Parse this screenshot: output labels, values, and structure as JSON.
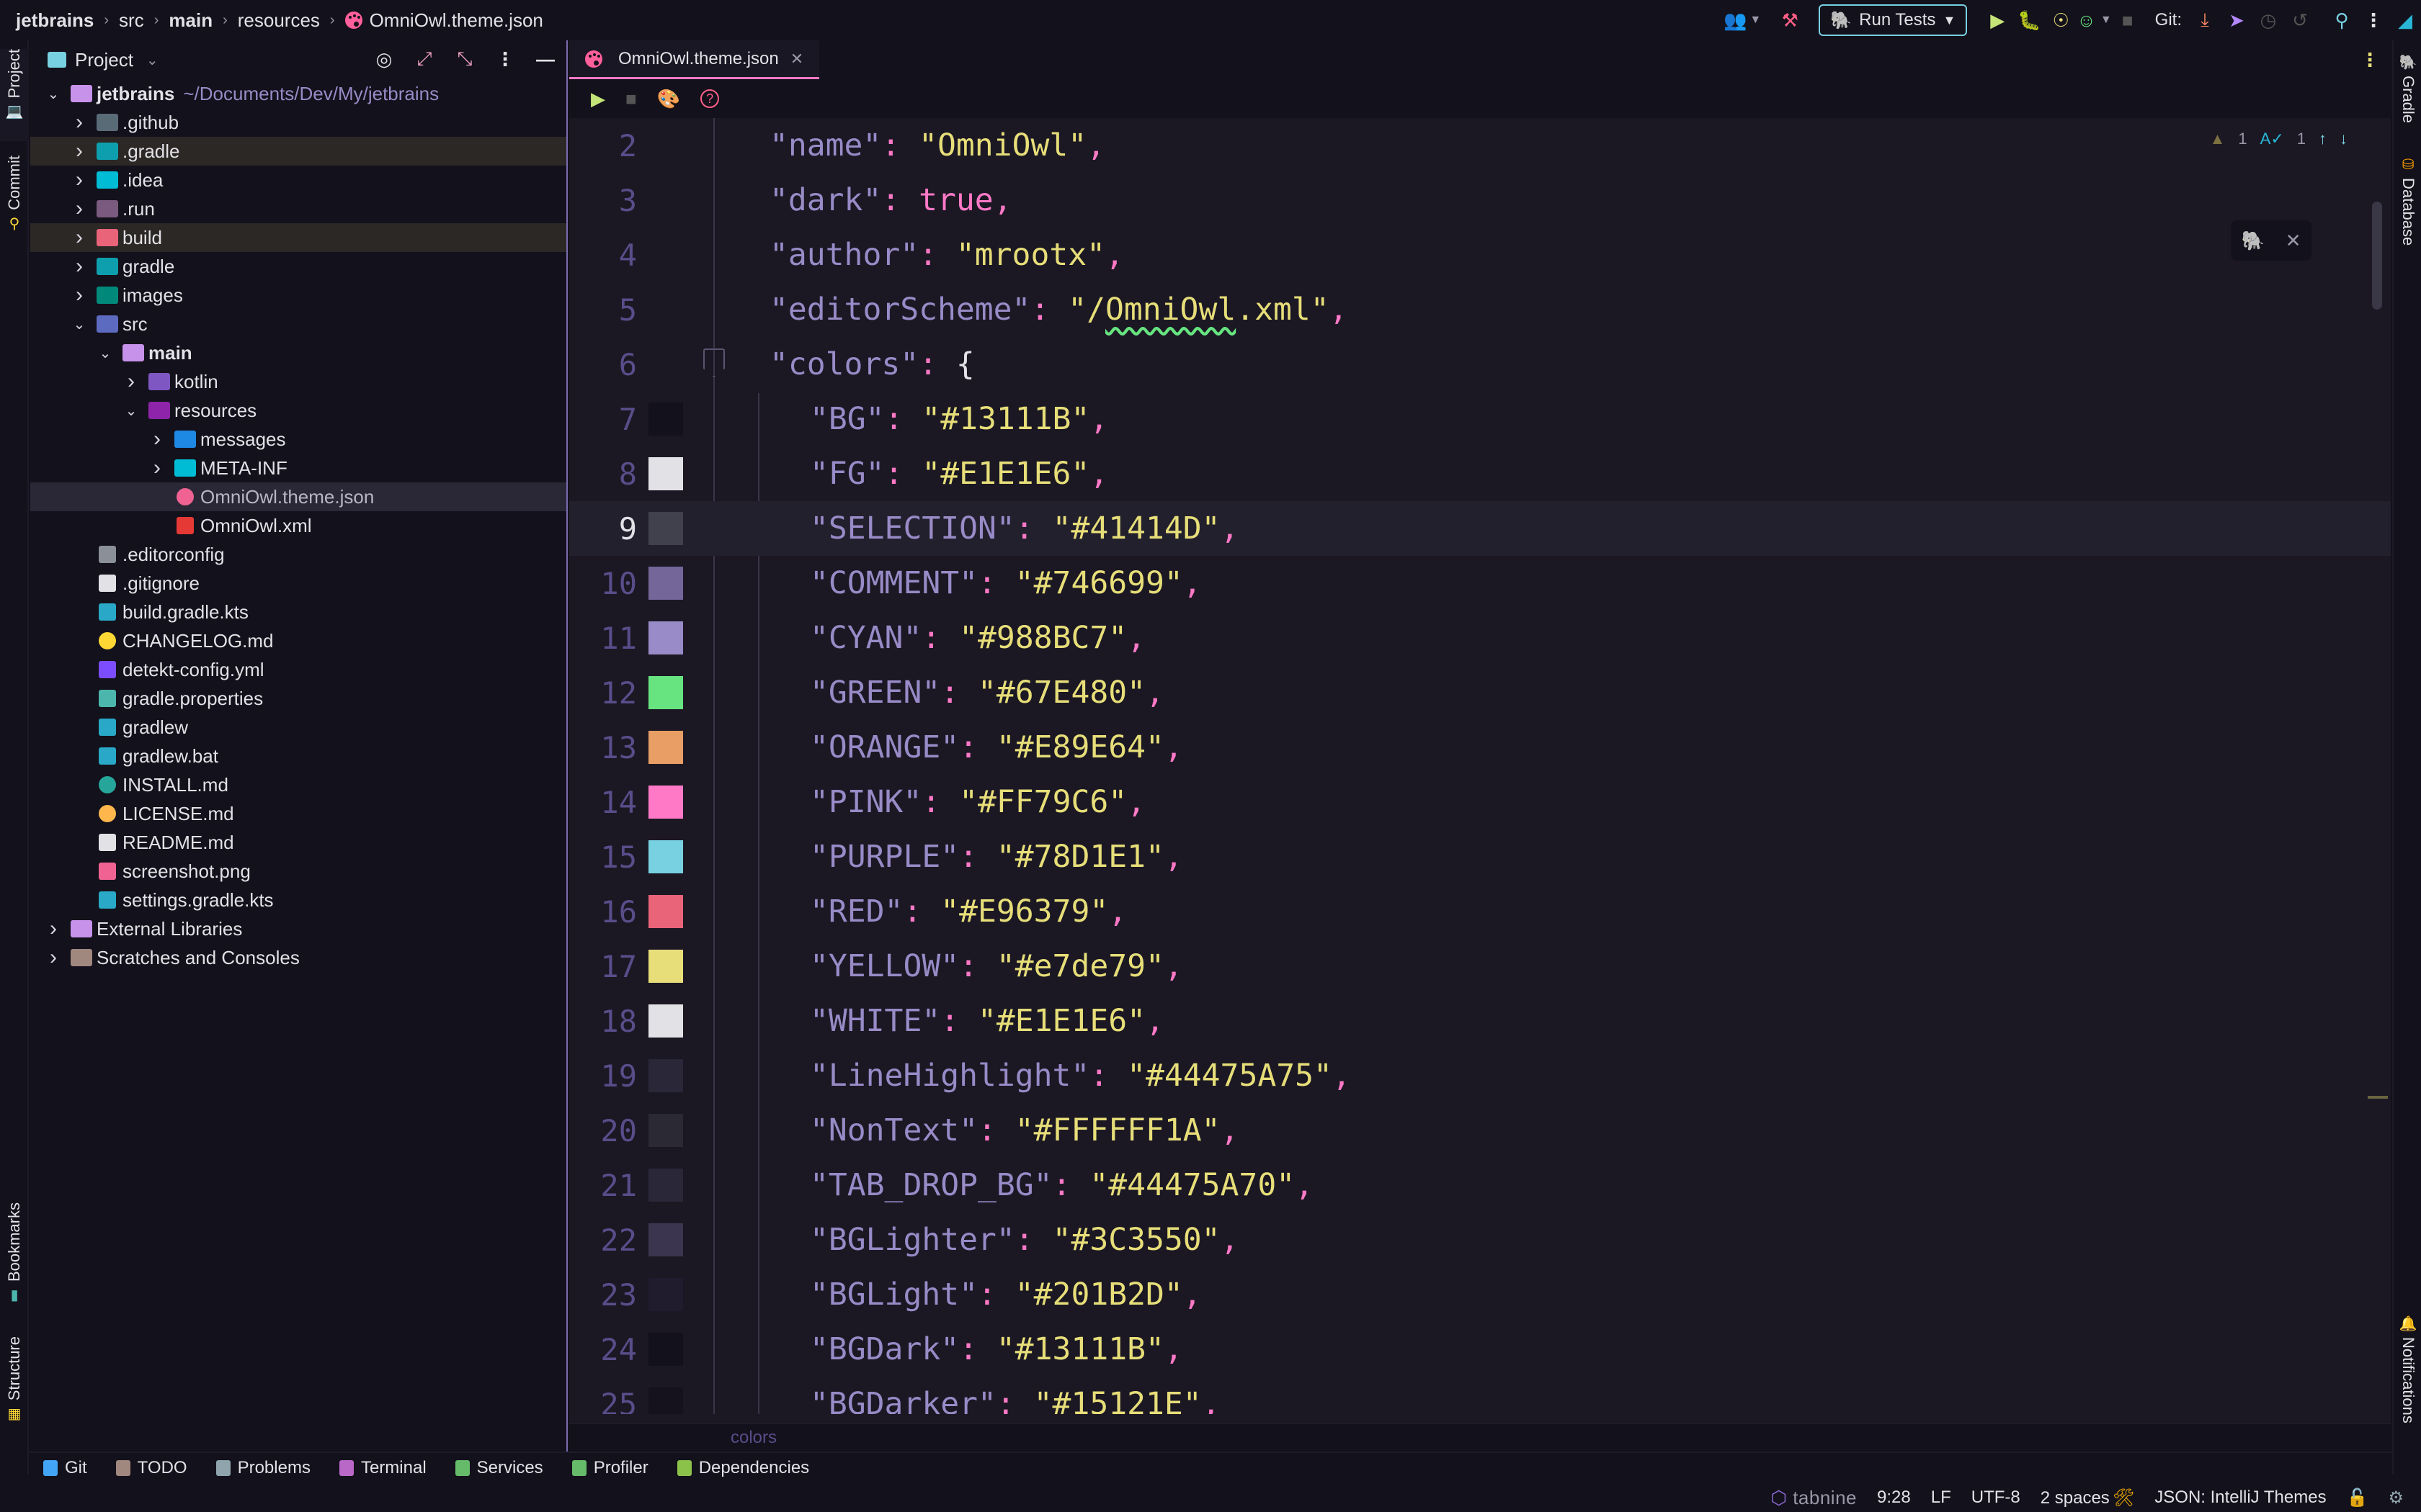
{
  "breadcrumb": [
    {
      "label": "jetbrains",
      "bold": true
    },
    {
      "label": "src",
      "bold": false
    },
    {
      "label": "main",
      "bold": true
    },
    {
      "label": "resources",
      "bold": false
    },
    {
      "label": "OmniOwl.theme.json",
      "bold": false,
      "icon": "palette-icon"
    }
  ],
  "toolbar": {
    "run_config_label": "Run Tests",
    "git_label": "Git:"
  },
  "left_strip": {
    "top": [
      {
        "label": "Project",
        "icon": "laptop-icon"
      },
      {
        "label": "Commit",
        "icon": "commit-icon"
      }
    ],
    "bottom": [
      {
        "label": "Bookmarks",
        "icon": "bookmark-icon"
      },
      {
        "label": "Structure",
        "icon": "structure-icon"
      }
    ]
  },
  "right_strip": {
    "top": [
      {
        "label": "Gradle",
        "icon": "gradle-icon"
      },
      {
        "label": "Database",
        "icon": "database-icon"
      }
    ],
    "bottom": [
      {
        "label": "Notifications",
        "icon": "bell-icon"
      }
    ]
  },
  "project_panel": {
    "title": "Project",
    "tree": [
      {
        "depth": 0,
        "arrow": "down",
        "name": "jetbrains",
        "path": "~/Documents/Dev/My/jetbrains",
        "bold": true,
        "icon": "module-folder",
        "color": "#C792EA"
      },
      {
        "depth": 1,
        "arrow": "right",
        "name": ".github",
        "icon": "github-folder",
        "color": "#5a6b78"
      },
      {
        "depth": 1,
        "arrow": "right",
        "name": ".gradle",
        "icon": "gradle-folder",
        "color": "#0e9fae",
        "state": "ignored"
      },
      {
        "depth": 1,
        "arrow": "right",
        "name": ".idea",
        "icon": "idea-folder",
        "color": "#00bcd4"
      },
      {
        "depth": 1,
        "arrow": "right",
        "name": ".run",
        "icon": "run-folder",
        "color": "#7a5a7e"
      },
      {
        "depth": 1,
        "arrow": "right",
        "name": "build",
        "icon": "build-folder",
        "color": "#E96379",
        "state": "ignored"
      },
      {
        "depth": 1,
        "arrow": "right",
        "name": "gradle",
        "icon": "gradle-folder",
        "color": "#0e9fae"
      },
      {
        "depth": 1,
        "arrow": "right",
        "name": "images",
        "icon": "images-folder",
        "color": "#00897b"
      },
      {
        "depth": 1,
        "arrow": "down",
        "name": "src",
        "icon": "src-folder",
        "color": "#5c6bc0"
      },
      {
        "depth": 2,
        "arrow": "down",
        "name": "main",
        "bold": true,
        "icon": "main-folder",
        "color": "#C792EA"
      },
      {
        "depth": 3,
        "arrow": "right",
        "name": "kotlin",
        "icon": "kotlin-folder",
        "color": "#7e57c2"
      },
      {
        "depth": 3,
        "arrow": "down",
        "name": "resources",
        "icon": "resources-folder",
        "color": "#8e24aa"
      },
      {
        "depth": 4,
        "arrow": "right",
        "name": "messages",
        "icon": "messages-folder",
        "color": "#1e88e5"
      },
      {
        "depth": 4,
        "arrow": "right",
        "name": "META-INF",
        "icon": "metainf-folder",
        "color": "#00bcd4"
      },
      {
        "depth": 4,
        "arrow": "none",
        "name": "OmniOwl.theme.json",
        "icon": "palette-file",
        "color": "#F06292",
        "state": "selected"
      },
      {
        "depth": 4,
        "arrow": "none",
        "name": "OmniOwl.xml",
        "icon": "xml-file",
        "color": "#E53935"
      },
      {
        "depth": 1,
        "arrow": "none",
        "name": ".editorconfig",
        "icon": "editorconfig-file",
        "color": "#8a8f98"
      },
      {
        "depth": 1,
        "arrow": "none",
        "name": ".gitignore",
        "icon": "git-file",
        "color": "#E1E1E6"
      },
      {
        "depth": 1,
        "arrow": "none",
        "name": "build.gradle.kts",
        "icon": "gradle-file",
        "color": "#29a8c7"
      },
      {
        "depth": 1,
        "arrow": "none",
        "name": "CHANGELOG.md",
        "icon": "changelog-file",
        "color": "#FDD835"
      },
      {
        "depth": 1,
        "arrow": "none",
        "name": "detekt-config.yml",
        "icon": "detekt-file",
        "color": "#7c4dff"
      },
      {
        "depth": 1,
        "arrow": "none",
        "name": "gradle.properties",
        "icon": "properties-file",
        "color": "#4db6ac"
      },
      {
        "depth": 1,
        "arrow": "none",
        "name": "gradlew",
        "icon": "gradle-file",
        "color": "#29a8c7"
      },
      {
        "depth": 1,
        "arrow": "none",
        "name": "gradlew.bat",
        "icon": "gradle-file",
        "color": "#29a8c7"
      },
      {
        "depth": 1,
        "arrow": "none",
        "name": "INSTALL.md",
        "icon": "install-file",
        "color": "#26a69a"
      },
      {
        "depth": 1,
        "arrow": "none",
        "name": "LICENSE.md",
        "icon": "license-file",
        "color": "#FFB74D"
      },
      {
        "depth": 1,
        "arrow": "none",
        "name": "README.md",
        "icon": "readme-file",
        "color": "#E1E1E6"
      },
      {
        "depth": 1,
        "arrow": "none",
        "name": "screenshot.png",
        "icon": "image-file",
        "color": "#F06292"
      },
      {
        "depth": 1,
        "arrow": "none",
        "name": "settings.gradle.kts",
        "icon": "gradle-file",
        "color": "#29a8c7"
      },
      {
        "depth": 0,
        "arrow": "right",
        "name": "External Libraries",
        "icon": "library-icon",
        "color": "#C792EA"
      },
      {
        "depth": 0,
        "arrow": "right",
        "name": "Scratches and Consoles",
        "icon": "scratches-icon",
        "color": "#a1887f"
      }
    ]
  },
  "editor": {
    "tab_label": "OmniOwl.theme.json",
    "inspections": {
      "warnings": "1",
      "typos": "1"
    },
    "breadcrumb": "colors",
    "current_line": 9,
    "lines": [
      {
        "n": "2",
        "indent": 1,
        "tokens": [
          [
            "k",
            "\"name\""
          ],
          [
            "p",
            ": "
          ],
          [
            "s",
            "\"OmniOwl\""
          ],
          [
            "p",
            ","
          ]
        ]
      },
      {
        "n": "3",
        "indent": 1,
        "tokens": [
          [
            "k",
            "\"dark\""
          ],
          [
            "p",
            ": "
          ],
          [
            "b",
            "true"
          ],
          [
            "p",
            ","
          ]
        ]
      },
      {
        "n": "4",
        "indent": 1,
        "tokens": [
          [
            "k",
            "\"author\""
          ],
          [
            "p",
            ": "
          ],
          [
            "s",
            "\"mrootx\""
          ],
          [
            "p",
            ","
          ]
        ]
      },
      {
        "n": "5",
        "indent": 1,
        "tokens": [
          [
            "k",
            "\"editorScheme\""
          ],
          [
            "p",
            ": "
          ],
          [
            "s",
            "\"/"
          ],
          [
            "sq",
            "OmniOwl"
          ],
          [
            "s",
            ".xml\""
          ],
          [
            "p",
            ","
          ]
        ]
      },
      {
        "n": "6",
        "indent": 1,
        "fold": true,
        "tokens": [
          [
            "k",
            "\"colors\""
          ],
          [
            "p",
            ": "
          ],
          [
            "w",
            "{"
          ]
        ]
      },
      {
        "n": "7",
        "indent": 2,
        "swatch": "#13111B",
        "tokens": [
          [
            "k",
            "\"BG\""
          ],
          [
            "p",
            ": "
          ],
          [
            "s",
            "\"#13111B\""
          ],
          [
            "p",
            ","
          ]
        ]
      },
      {
        "n": "8",
        "indent": 2,
        "swatch": "#E1E1E6",
        "tokens": [
          [
            "k",
            "\"FG\""
          ],
          [
            "p",
            ": "
          ],
          [
            "s",
            "\"#E1E1E6\""
          ],
          [
            "p",
            ","
          ]
        ]
      },
      {
        "n": "9",
        "indent": 2,
        "swatch": "#41414D",
        "tokens": [
          [
            "k",
            "\"SELECTION\""
          ],
          [
            "p",
            ": "
          ],
          [
            "s",
            "\"#41414D\""
          ],
          [
            "p",
            ","
          ]
        ]
      },
      {
        "n": "10",
        "indent": 2,
        "swatch": "#746699",
        "tokens": [
          [
            "k",
            "\"COMMENT\""
          ],
          [
            "p",
            ": "
          ],
          [
            "s",
            "\"#746699\""
          ],
          [
            "p",
            ","
          ]
        ]
      },
      {
        "n": "11",
        "indent": 2,
        "swatch": "#988BC7",
        "tokens": [
          [
            "k",
            "\"CYAN\""
          ],
          [
            "p",
            ": "
          ],
          [
            "s",
            "\"#988BC7\""
          ],
          [
            "p",
            ","
          ]
        ]
      },
      {
        "n": "12",
        "indent": 2,
        "swatch": "#67E480",
        "tokens": [
          [
            "k",
            "\"GREEN\""
          ],
          [
            "p",
            ": "
          ],
          [
            "s",
            "\"#67E480\""
          ],
          [
            "p",
            ","
          ]
        ]
      },
      {
        "n": "13",
        "indent": 2,
        "swatch": "#E89E64",
        "tokens": [
          [
            "k",
            "\"ORANGE\""
          ],
          [
            "p",
            ": "
          ],
          [
            "s",
            "\"#E89E64\""
          ],
          [
            "p",
            ","
          ]
        ]
      },
      {
        "n": "14",
        "indent": 2,
        "swatch": "#FF79C6",
        "tokens": [
          [
            "k",
            "\"PINK\""
          ],
          [
            "p",
            ": "
          ],
          [
            "s",
            "\"#FF79C6\""
          ],
          [
            "p",
            ","
          ]
        ]
      },
      {
        "n": "15",
        "indent": 2,
        "swatch": "#78D1E1",
        "tokens": [
          [
            "k",
            "\"PURPLE\""
          ],
          [
            "p",
            ": "
          ],
          [
            "s",
            "\"#78D1E1\""
          ],
          [
            "p",
            ","
          ]
        ]
      },
      {
        "n": "16",
        "indent": 2,
        "swatch": "#E96379",
        "tokens": [
          [
            "k",
            "\"RED\""
          ],
          [
            "p",
            ": "
          ],
          [
            "s",
            "\"#E96379\""
          ],
          [
            "p",
            ","
          ]
        ]
      },
      {
        "n": "17",
        "indent": 2,
        "swatch": "#e7de79",
        "tokens": [
          [
            "k",
            "\"YELLOW\""
          ],
          [
            "p",
            ": "
          ],
          [
            "s",
            "\"#e7de79\""
          ],
          [
            "p",
            ","
          ]
        ]
      },
      {
        "n": "18",
        "indent": 2,
        "swatch": "#E1E1E6",
        "tokens": [
          [
            "k",
            "\"WHITE\""
          ],
          [
            "p",
            ": "
          ],
          [
            "s",
            "\"#E1E1E6\""
          ],
          [
            "p",
            ","
          ]
        ]
      },
      {
        "n": "19",
        "indent": 2,
        "swatch": "#2a2838",
        "tokens": [
          [
            "k",
            "\"LineHighlight\""
          ],
          [
            "p",
            ": "
          ],
          [
            "s",
            "\"#44475A75\""
          ],
          [
            "p",
            ","
          ]
        ]
      },
      {
        "n": "20",
        "indent": 2,
        "swatch": "#2b2934",
        "tokens": [
          [
            "k",
            "\"NonText\""
          ],
          [
            "p",
            ": "
          ],
          [
            "s",
            "\"#FFFFFF1A\""
          ],
          [
            "p",
            ","
          ]
        ]
      },
      {
        "n": "21",
        "indent": 2,
        "swatch": "#2a2838",
        "tokens": [
          [
            "k",
            "\"TAB_DROP_BG\""
          ],
          [
            "p",
            ": "
          ],
          [
            "s",
            "\"#44475A70\""
          ],
          [
            "p",
            ","
          ]
        ]
      },
      {
        "n": "22",
        "indent": 2,
        "swatch": "#3C3550",
        "tokens": [
          [
            "k",
            "\"BGLighter\""
          ],
          [
            "p",
            ": "
          ],
          [
            "s",
            "\"#3C3550\""
          ],
          [
            "p",
            ","
          ]
        ]
      },
      {
        "n": "23",
        "indent": 2,
        "swatch": "#201B2D",
        "tokens": [
          [
            "k",
            "\"BGLight\""
          ],
          [
            "p",
            ": "
          ],
          [
            "s",
            "\"#201B2D\""
          ],
          [
            "p",
            ","
          ]
        ]
      },
      {
        "n": "24",
        "indent": 2,
        "swatch": "#13111B",
        "tokens": [
          [
            "k",
            "\"BGDark\""
          ],
          [
            "p",
            ": "
          ],
          [
            "s",
            "\"#13111B\""
          ],
          [
            "p",
            ","
          ]
        ]
      },
      {
        "n": "25",
        "indent": 2,
        "swatch": "#15121E",
        "tokens": [
          [
            "k",
            "\"BGDarker\""
          ],
          [
            "p",
            ": "
          ],
          [
            "s",
            "\"#15121E\""
          ],
          [
            "p",
            ","
          ]
        ]
      }
    ]
  },
  "bottom_tools": [
    {
      "label": "Git",
      "icon": "git-branch-icon",
      "color": "#42a5f5"
    },
    {
      "label": "TODO",
      "icon": "todo-icon",
      "color": "#a1887f"
    },
    {
      "label": "Problems",
      "icon": "problems-icon",
      "color": "#90a4ae"
    },
    {
      "label": "Terminal",
      "icon": "terminal-icon",
      "color": "#ba68c8"
    },
    {
      "label": "Services",
      "icon": "services-icon",
      "color": "#66bb6a"
    },
    {
      "label": "Profiler",
      "icon": "profiler-icon",
      "color": "#66bb6a"
    },
    {
      "label": "Dependencies",
      "icon": "dependencies-icon",
      "color": "#8bc34a"
    }
  ],
  "status_bar": {
    "plugin": "tabnine",
    "caret": "9:28",
    "line_separator": "LF",
    "encoding": "UTF-8",
    "indent": "2 spaces",
    "file_type": "JSON: IntelliJ Themes"
  },
  "colors": {
    "accent_pink": "#FF79C6",
    "bg": "#13111B",
    "key": "#988BC7",
    "string": "#E7DE79"
  }
}
